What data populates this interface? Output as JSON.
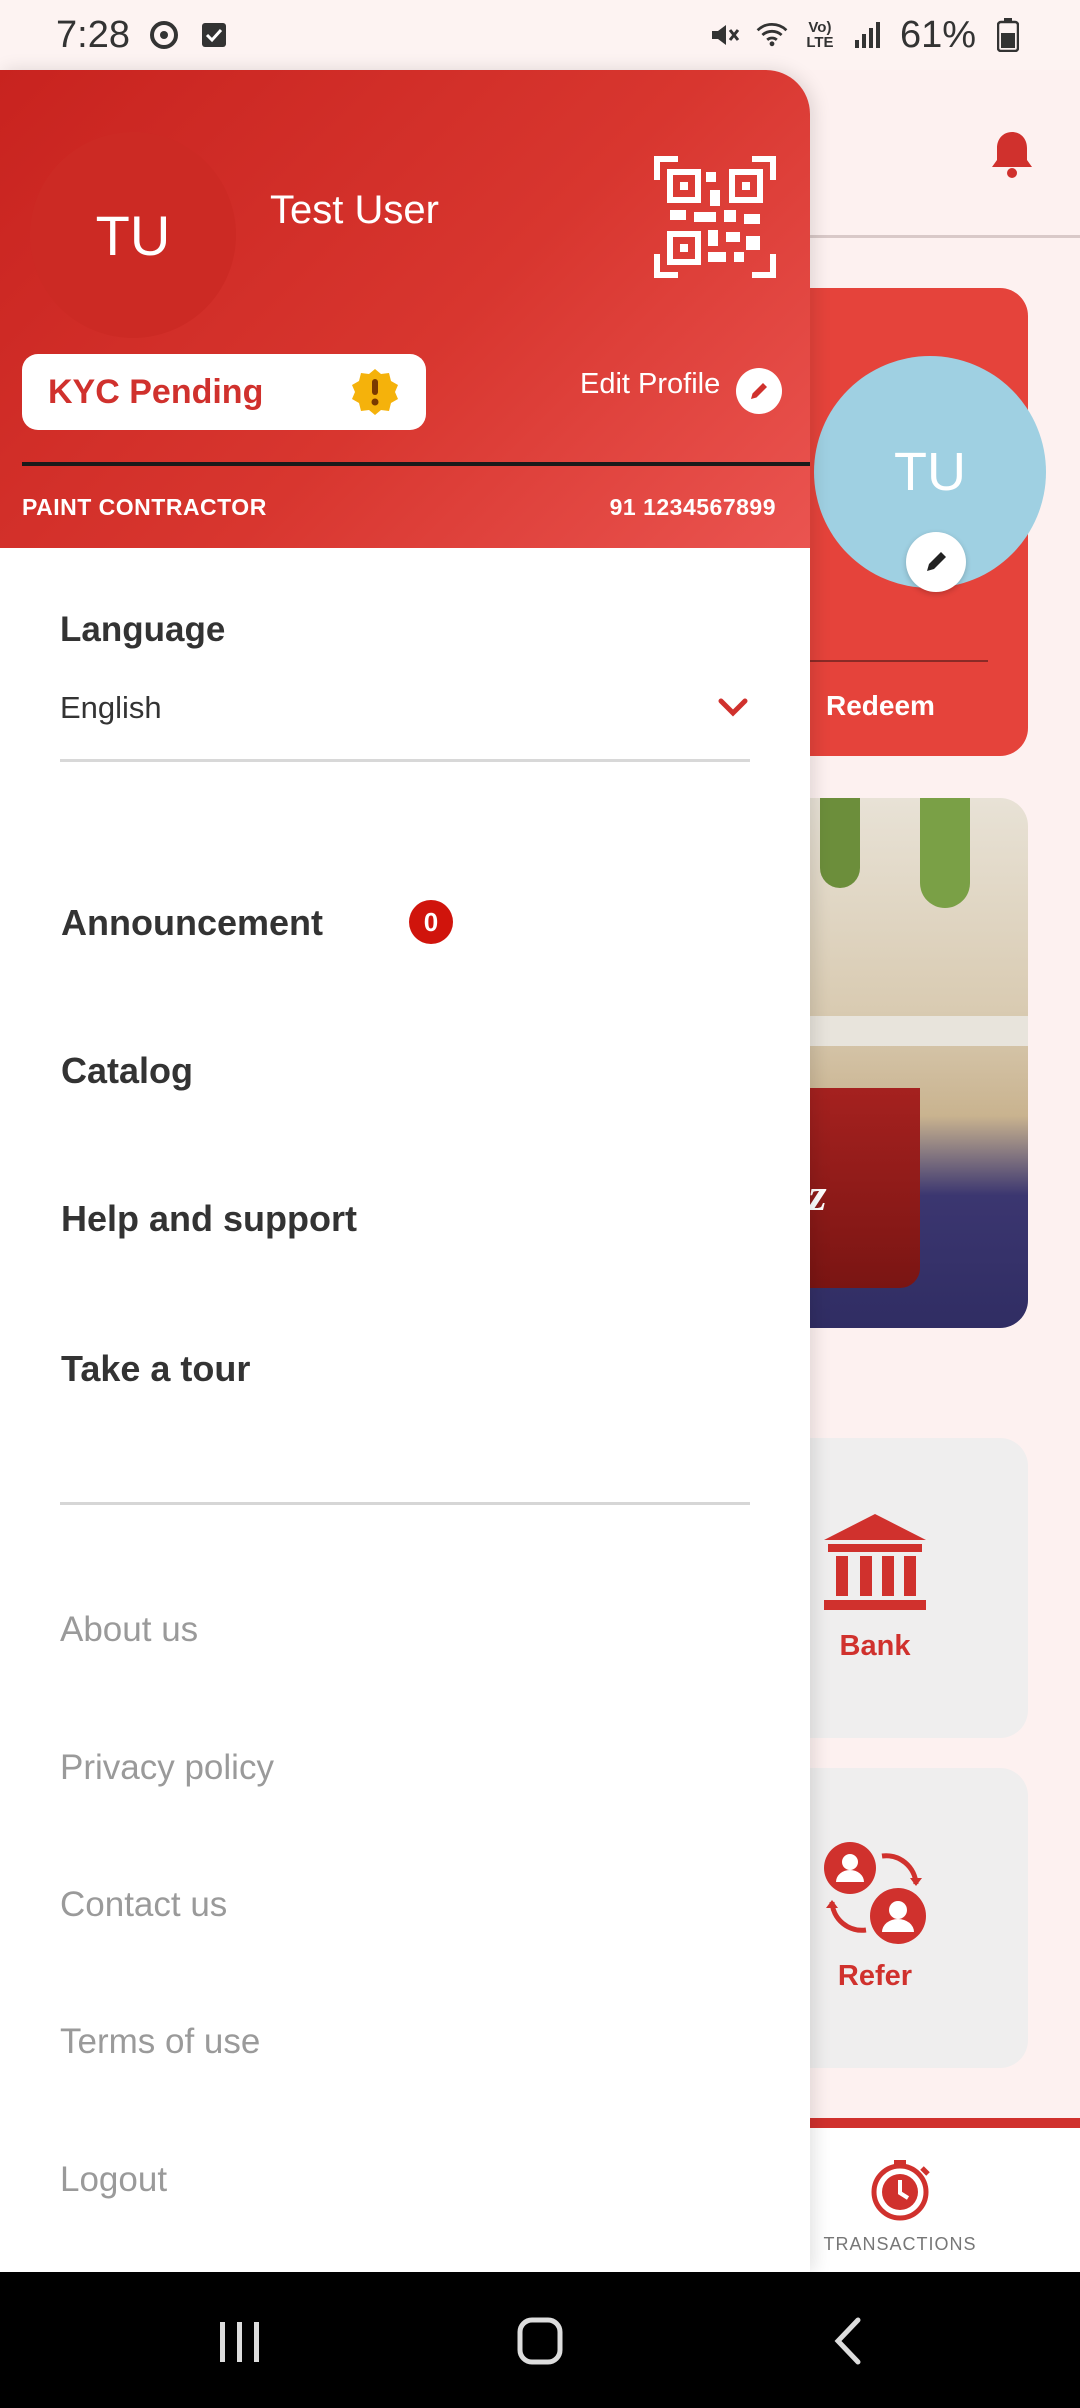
{
  "status_bar": {
    "time": "7:28",
    "battery": "61%",
    "icons": [
      "threads-icon",
      "checkbox-icon",
      "mute-icon",
      "wifi-icon",
      "volte-icon",
      "signal-icon",
      "battery-icon"
    ]
  },
  "background": {
    "avatar_initials": "TU",
    "redeem_label": "Redeem",
    "bank_label": "Bank",
    "refer_label": "Refer",
    "transactions_label": "TRANSACTIONS",
    "banner_text": "anz",
    "accent_color": "#d0312d"
  },
  "drawer": {
    "avatar_initials": "TU",
    "user_name": "Test User",
    "kyc_status": "KYC Pending",
    "edit_profile_label": "Edit Profile",
    "role": "PAINT CONTRACTOR",
    "phone": "91 1234567899",
    "language": {
      "title": "Language",
      "value": "English"
    },
    "menu": [
      {
        "label": "Announcement",
        "badge": "0"
      },
      {
        "label": "Catalog"
      },
      {
        "label": "Help and support"
      },
      {
        "label": "Take a tour"
      }
    ],
    "links": [
      "About us",
      "Privacy policy",
      "Contact us",
      "Terms of use",
      "Logout"
    ]
  }
}
